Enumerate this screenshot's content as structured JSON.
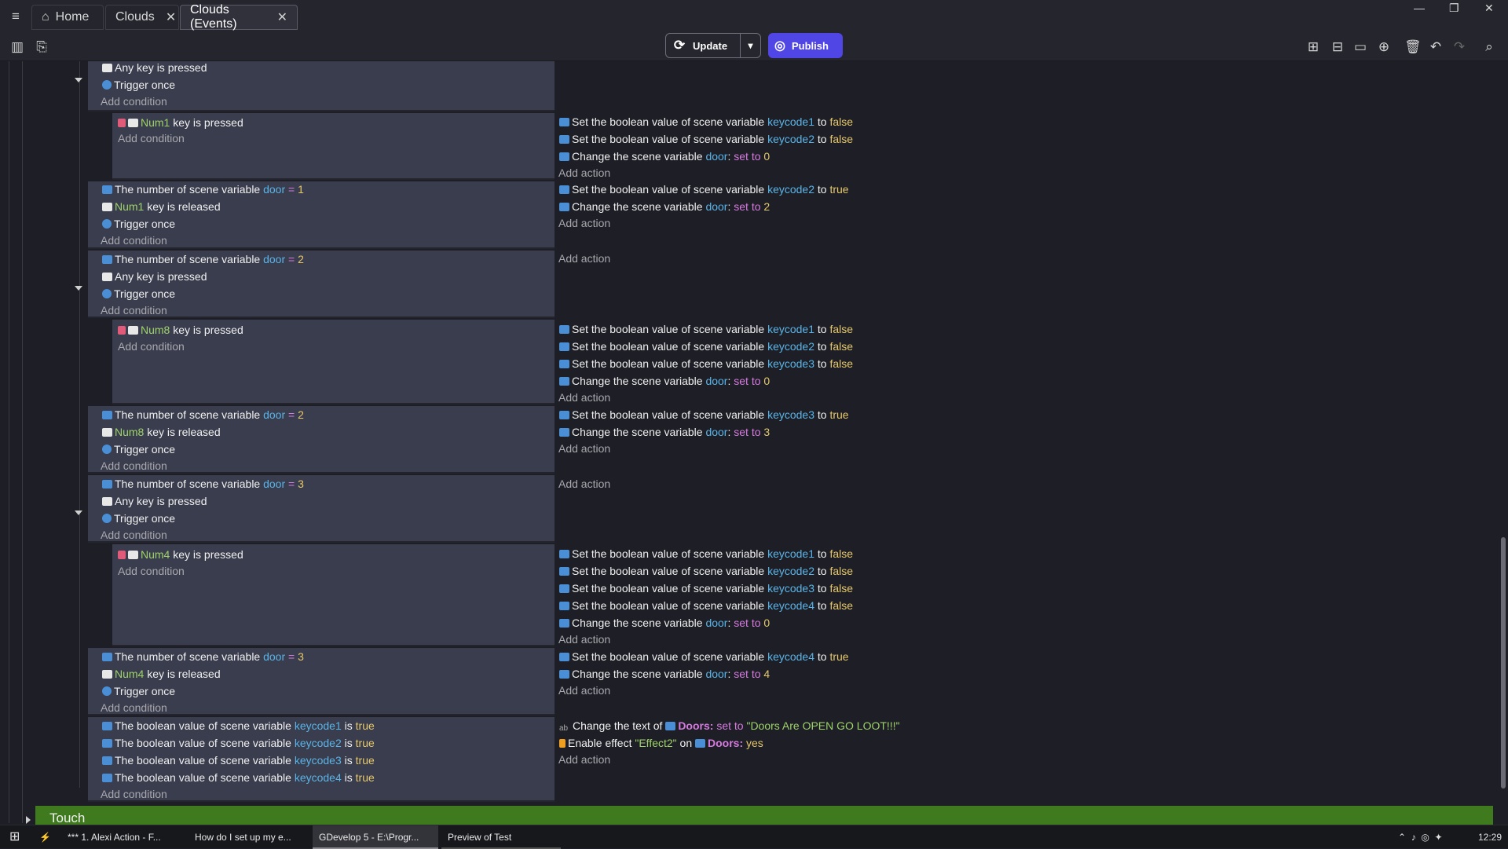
{
  "tabs": [
    {
      "label": "Home",
      "icon": "home-icon"
    },
    {
      "label": "Clouds"
    },
    {
      "label": "Clouds (Events)"
    }
  ],
  "toolbar": {
    "update_label": "Update",
    "publish_label": "Publish"
  },
  "events": {
    "e1_conds": [
      "Any key is pressed",
      "Trigger once"
    ],
    "add_condition": "Add condition",
    "add_action": "Add action",
    "set_bool": "Set the boolean value of scene variable",
    "change_var": "Change the scene variable",
    "num_scene": "The number of scene variable",
    "bool_scene": "The boolean value of scene variable",
    "key_pressed": "key is pressed",
    "key_released": "key is released",
    "any_key": "Any key is pressed",
    "trigger": "Trigger once",
    "to": "to",
    "is": "is",
    "set_to": "set to",
    "eq": "=",
    "kc1": "keycode1",
    "kc2": "keycode2",
    "kc3": "keycode3",
    "kc4": "keycode4",
    "door": "door",
    "true": "true",
    "false": "false",
    "n0": "0",
    "n1": "1",
    "n2": "2",
    "n3": "3",
    "n4": "4",
    "num1": "Num1",
    "num8": "Num8",
    "num4": "Num4",
    "change_text": "Change the text of",
    "doors": "Doors:",
    "text_val": "\"Doors Are OPEN GO LOOT!!!\"",
    "enable_effect": "Enable effect",
    "effect_name": "\"Effect2\"",
    "on": "on",
    "yes": "yes"
  },
  "touch_group": "Touch",
  "taskbar": [
    "*** 1. Alexi Action - F...",
    "How do I set up my e...",
    "GDevelop 5 - E:\\Progr...",
    "Preview of Test"
  ],
  "clock": "12:29"
}
